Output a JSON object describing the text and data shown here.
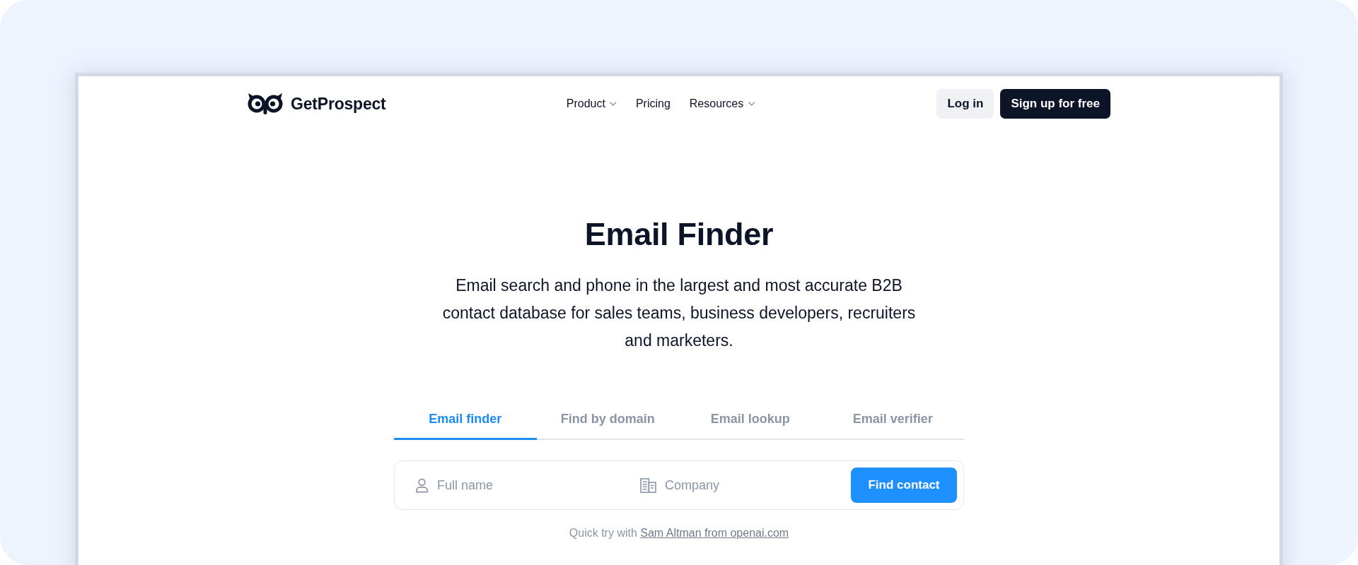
{
  "header": {
    "logo": {
      "text": "GetProspect"
    },
    "nav": [
      {
        "label": "Product",
        "has_menu": true
      },
      {
        "label": "Pricing",
        "has_menu": false
      },
      {
        "label": "Resources",
        "has_menu": true
      }
    ],
    "login_button": "Log in",
    "signup_button": "Sign up for free"
  },
  "hero": {
    "title": "Email Finder",
    "subtitle": "Email search and phone in the largest and most accurate B2B contact database for sales teams, business developers, recruiters and marketers."
  },
  "tabs": [
    {
      "label": "Email finder",
      "selected": true
    },
    {
      "label": "Find by domain",
      "selected": false
    },
    {
      "label": "Email lookup",
      "selected": false
    },
    {
      "label": "Email verifier",
      "selected": false
    }
  ],
  "search": {
    "fields": [
      {
        "kind": "person",
        "placeholder": "Full name"
      },
      {
        "kind": "company",
        "placeholder": "Company"
      }
    ],
    "button": "Find contact"
  },
  "quick_try": {
    "text": "Quick try with",
    "link": "Sam Altman from openai.com"
  }
}
